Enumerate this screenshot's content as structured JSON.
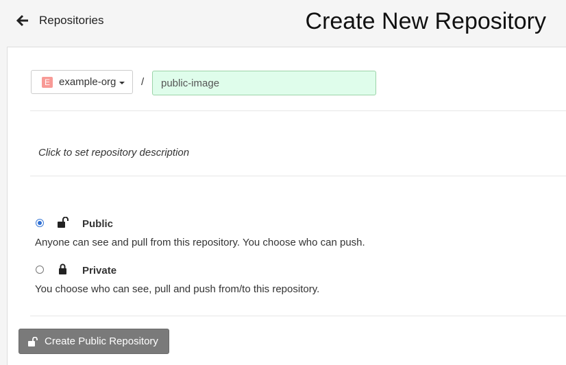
{
  "header": {
    "back_label": "Repositories",
    "title": "Create New Repository"
  },
  "repository": {
    "namespace": {
      "avatar_letter": "E",
      "avatar_color": "#f89a96",
      "label": "example-org"
    },
    "separator": "/",
    "name_value": "public-image",
    "description_placeholder": "Click to set repository description"
  },
  "visibility": {
    "options": [
      {
        "title": "Public",
        "description": "Anyone can see and pull from this repository. You choose who can push.",
        "icon": "unlock-icon",
        "selected": true
      },
      {
        "title": "Private",
        "description": "You choose who can see, pull and push from/to this repository.",
        "icon": "lock-icon",
        "selected": false
      }
    ]
  },
  "actions": {
    "create_label": "Create Public Repository",
    "create_icon": "unlock-icon"
  },
  "colors": {
    "name_input_bg": "#dffdeb",
    "radio_selected": "#2f6fd3",
    "create_button_bg": "#7a7a7a"
  }
}
